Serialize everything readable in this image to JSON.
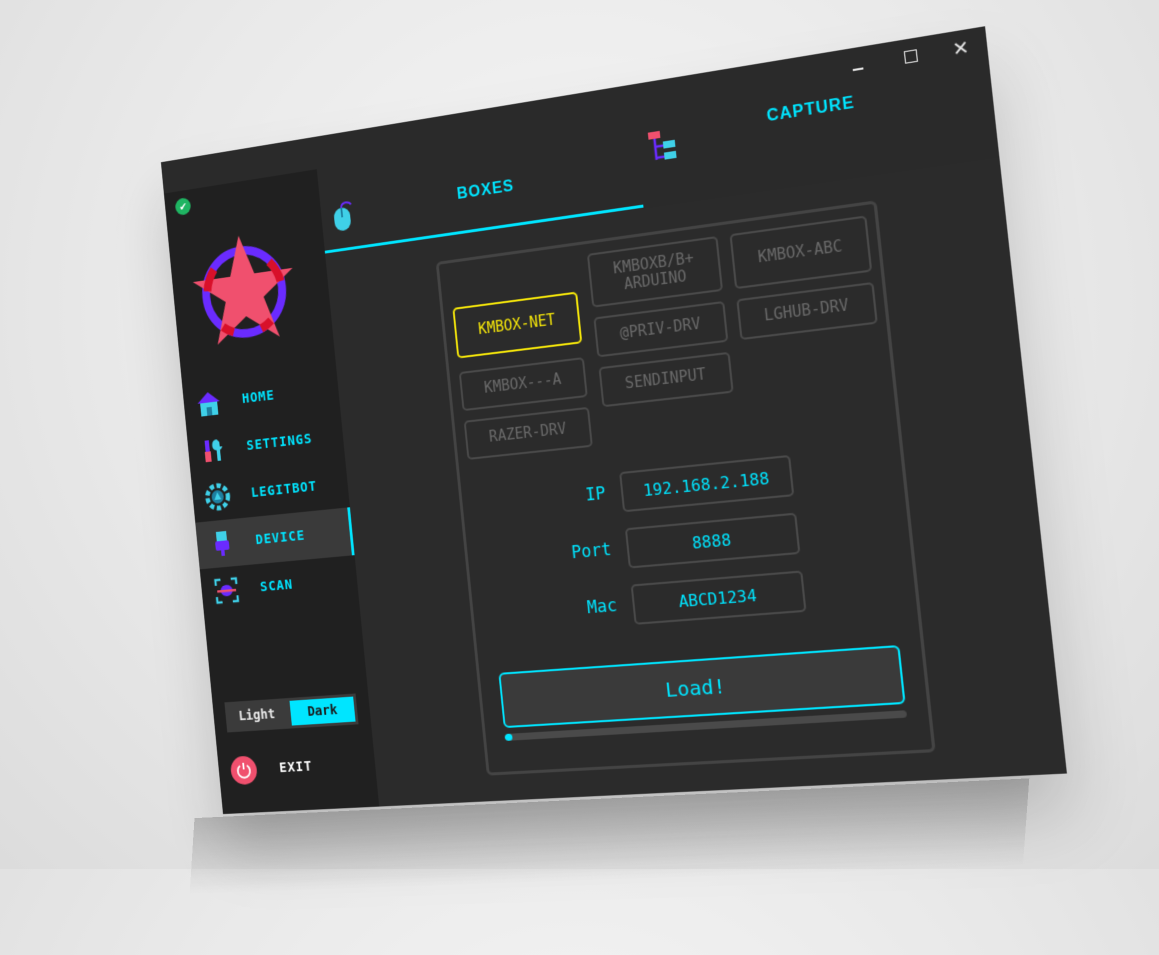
{
  "window": {
    "close_glyph": "✕"
  },
  "sidebar": {
    "items": [
      {
        "label": "HOME",
        "icon": "home-icon"
      },
      {
        "label": "SETTINGS",
        "icon": "tools-icon"
      },
      {
        "label": "LEGITBOT",
        "icon": "gear-icon"
      },
      {
        "label": "DEVICE",
        "icon": "usb-icon",
        "active": true
      },
      {
        "label": "SCAN",
        "icon": "scan-icon"
      }
    ],
    "theme": {
      "light": "Light",
      "dark": "Dark",
      "selected": "Dark"
    },
    "exit_label": "EXIT"
  },
  "tabs": [
    {
      "label": "BOXES",
      "icon": "mouse-icon",
      "active": true
    },
    {
      "label": "CAPTURE",
      "icon": "hierarchy-icon",
      "active": false
    }
  ],
  "devices": {
    "selected": "KMBOX-NET",
    "col1": [
      "KMBOX-NET",
      "KMBOX---A",
      "RAZER-DRV"
    ],
    "col2": [
      "KMBOXB/B+ ARDUINO",
      "@PRIV-DRV",
      "SENDINPUT"
    ],
    "col3": [
      "KMBOX-ABC",
      "LGHUB-DRV"
    ]
  },
  "fields": {
    "ip": {
      "label": "IP",
      "value": "192.168.2.188"
    },
    "port": {
      "label": "Port",
      "value": "8888"
    },
    "mac": {
      "label": "Mac",
      "value": "ABCD1234"
    }
  },
  "load_label": "Load!",
  "progress": 0.02,
  "colors": {
    "accent": "#00e5ff",
    "selected": "#f5e60a",
    "exit": "#f0506e",
    "logo_star": "#f0506e",
    "logo_ring": "#6a2bff"
  }
}
